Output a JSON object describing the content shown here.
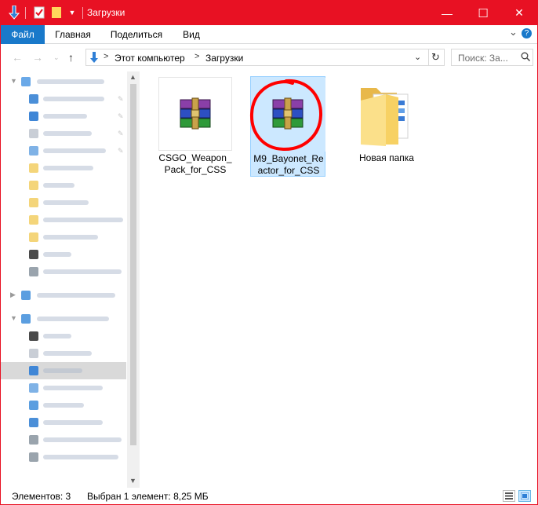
{
  "window": {
    "title": "Загрузки",
    "controls": {
      "minimize": "—",
      "maximize": "☐",
      "close": "✕"
    }
  },
  "ribbon": {
    "tabs": [
      "Файл",
      "Главная",
      "Поделиться",
      "Вид"
    ],
    "collapse_glyph": "⌄",
    "help_glyph": "?"
  },
  "address": {
    "segments": [
      "Этот компьютер",
      "Загрузки"
    ],
    "separator": ">",
    "search_placeholder": "Поиск: За..."
  },
  "files": [
    {
      "name": "CSGO_Weapon_Pack_for_CSS",
      "icon": "winrar-archive-icon",
      "selected": false
    },
    {
      "name": "M9_Bayonet_Reactor_for_CSS",
      "icon": "winrar-archive-icon",
      "selected": true
    },
    {
      "name": "Новая папка",
      "icon": "folder-icon",
      "selected": false
    }
  ],
  "status": {
    "count": "Элементов: 3",
    "selection": "Выбран 1 элемент: 8,25 МБ"
  },
  "colors": {
    "titlebar": "#e81123",
    "file_tab": "#1979ca",
    "selection_fill": "#cce8ff",
    "selection_border": "#99d1ff",
    "annotation_circle": "#ff0000"
  }
}
